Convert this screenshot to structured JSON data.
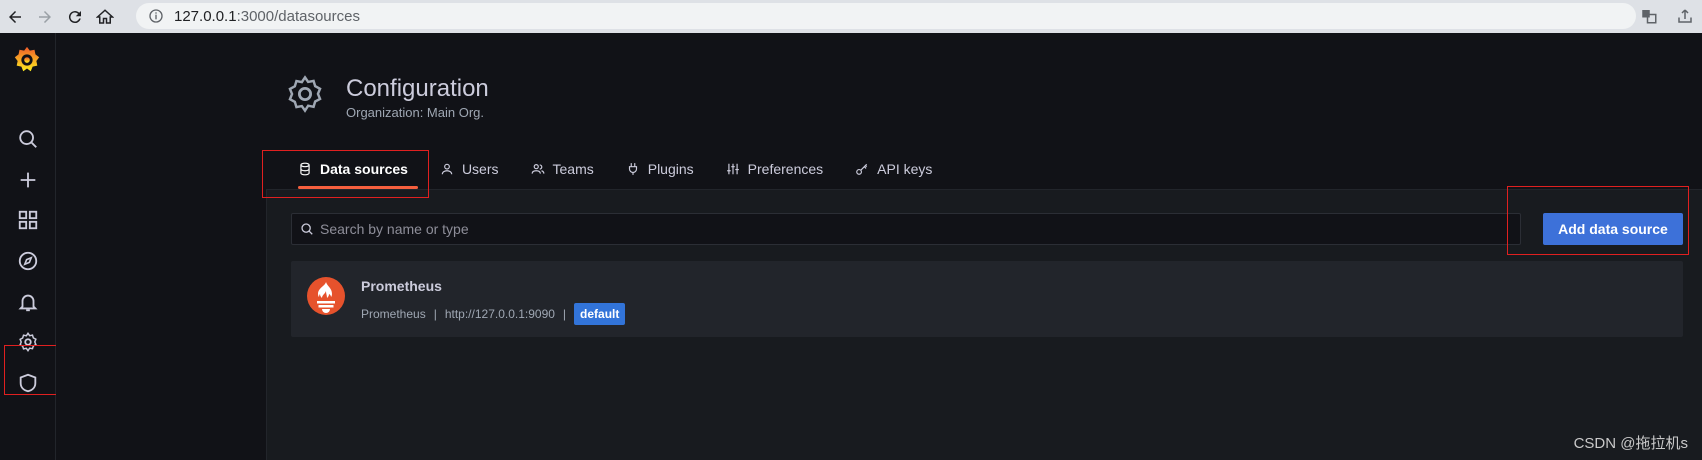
{
  "browser": {
    "url_host": "127.0.0.1",
    "url_path": ":3000/datasources"
  },
  "header": {
    "title": "Configuration",
    "subtitle": "Organization: Main Org."
  },
  "tabs": [
    {
      "label": "Data sources",
      "icon": "database-icon",
      "active": true
    },
    {
      "label": "Users",
      "icon": "user-icon",
      "active": false
    },
    {
      "label": "Teams",
      "icon": "users-icon",
      "active": false
    },
    {
      "label": "Plugins",
      "icon": "plug-icon",
      "active": false
    },
    {
      "label": "Preferences",
      "icon": "sliders-icon",
      "active": false
    },
    {
      "label": "API keys",
      "icon": "key-icon",
      "active": false
    }
  ],
  "search": {
    "placeholder": "Search by name or type"
  },
  "add_button": {
    "label": "Add data source"
  },
  "datasources": [
    {
      "name": "Prometheus",
      "type": "Prometheus",
      "url": "http://127.0.0.1:9090",
      "badge": "default",
      "icon": "prometheus-logo-icon"
    }
  ],
  "sidemenu": {
    "items": [
      "search-icon",
      "plus-icon",
      "apps-icon",
      "compass-icon",
      "bell-icon",
      "cog-icon",
      "shield-icon"
    ]
  },
  "watermark": "CSDN @拖拉机s",
  "colors": {
    "accent": "#f55f3e",
    "primary_button": "#3d71d9",
    "badge": "#3274d9",
    "highlight_box": "#e02020"
  }
}
